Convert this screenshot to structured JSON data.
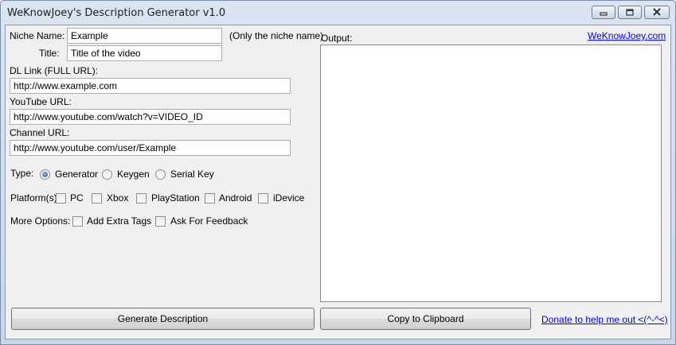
{
  "window": {
    "title": "WeKnowJoey's Description Generator v1.0"
  },
  "form": {
    "niche_label": "Niche Name:",
    "niche_value": "Example",
    "niche_hint": "(Only the niche name)",
    "title_label": "Title:",
    "title_value": "Title of the video",
    "dl_label": "DL Link (FULL URL):",
    "dl_value": "http://www.example.com",
    "youtube_label": "YouTube URL:",
    "youtube_value": "http://www.youtube.com/watch?v=VIDEO_ID",
    "channel_label": "Channel URL:",
    "channel_value": "http://www.youtube.com/user/Example"
  },
  "type": {
    "label": "Type:",
    "options": [
      "Generator",
      "Keygen",
      "Serial Key"
    ],
    "selected": "Generator"
  },
  "platforms": {
    "label": "Platform(s):",
    "options": [
      "PC",
      "Xbox",
      "PlayStation",
      "Android",
      "iDevice"
    ]
  },
  "more_options": {
    "label": "More Options:",
    "options": [
      "Add Extra Tags",
      "Ask For Feedback"
    ]
  },
  "output": {
    "label": "Output:",
    "site_link": "WeKnowJoey.com"
  },
  "buttons": {
    "generate": "Generate Description",
    "copy": "Copy to Clipboard",
    "donate": "Donate to help me out <(^-^<)"
  }
}
